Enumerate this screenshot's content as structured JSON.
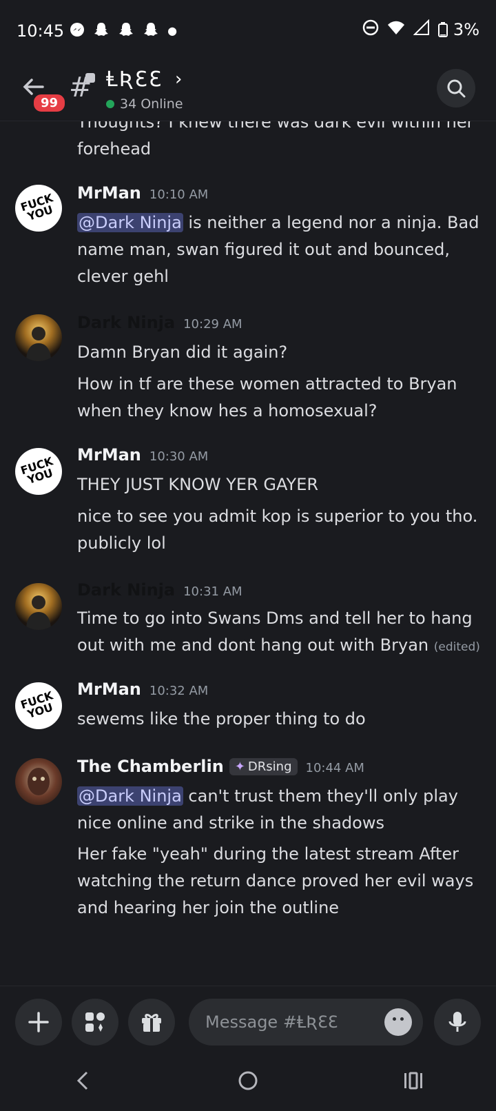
{
  "status_bar": {
    "time": "10:45",
    "notification_icons": [
      "messenger-icon",
      "snapchat-icon",
      "snapchat-icon",
      "snapchat-icon",
      "dot-icon"
    ],
    "battery": "3%"
  },
  "header": {
    "unread_badge": "99",
    "channel_name": "ⱠƦƐƐ",
    "online_count": "34 Online"
  },
  "messages": [
    {
      "type": "continuation",
      "text": "Thoughts? I knew there was dark evil within her forehead"
    },
    {
      "author": "MrMan",
      "avatar_text": "FUCK YOU",
      "time": "10:10 AM",
      "lines": [
        {
          "mention": "@Dark Ninja",
          "text": " is neither a legend nor a ninja. Bad name man, swan figured it out and bounced, clever gehl"
        }
      ]
    },
    {
      "author": "Dark Ninja",
      "time": "10:29 AM",
      "lines": [
        {
          "text": "Damn Bryan did it again?"
        },
        {
          "text": "How in tf are these women attracted to Bryan when they know hes a homosexual?"
        }
      ]
    },
    {
      "author": "MrMan",
      "avatar_text": "FUCK YOU",
      "time": "10:30 AM",
      "lines": [
        {
          "text": "THEY JUST KNOW YER GAYER"
        },
        {
          "text": "nice to see you admit kop is superior to you tho. publicly lol"
        }
      ]
    },
    {
      "author": "Dark Ninja",
      "time": "10:31 AM",
      "lines": [
        {
          "text": "Time to go into Swans Dms and tell her to hang out with me and dont hang out with Bryan",
          "edited": "(edited)"
        }
      ]
    },
    {
      "author": "MrMan",
      "avatar_text": "FUCK YOU",
      "time": "10:32 AM",
      "lines": [
        {
          "text": "sewems like the proper thing to do"
        }
      ]
    },
    {
      "author": "The Chamberlin",
      "role_tag": "DRsing",
      "time": "10:44 AM",
      "lines": [
        {
          "mention": "@Dark Ninja",
          "text": " can't trust them they'll only play nice online and strike in the shadows"
        },
        {
          "text": "Her fake \"yeah\" during the latest stream After watching the return dance proved her evil ways and hearing her join the outline"
        }
      ]
    }
  ],
  "input": {
    "placeholder": "Message #ⱠƦƐƐ"
  },
  "colors": {
    "background": "#1a1b1f",
    "mention_bg": "#3c4270",
    "badge": "#e63d44",
    "online": "#23a55a"
  }
}
